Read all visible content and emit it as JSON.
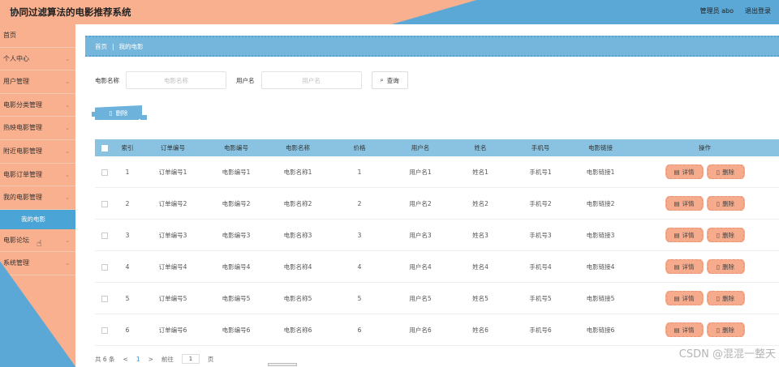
{
  "header": {
    "title": "协同过滤算法的电影推荐系统",
    "admin_label": "管理员 abo",
    "logout_label": "退出登录"
  },
  "sidebar": {
    "items": [
      {
        "label": "首页",
        "chevron": false
      },
      {
        "label": "个人中心",
        "chevron": true
      },
      {
        "label": "用户管理",
        "chevron": true
      },
      {
        "label": "电影分类管理",
        "chevron": true
      },
      {
        "label": "热映电影管理",
        "chevron": true
      },
      {
        "label": "附近电影管理",
        "chevron": true
      },
      {
        "label": "电影订单管理",
        "chevron": true
      },
      {
        "label": "我的电影管理",
        "chevron": true
      }
    ],
    "active_sub": "我的电影",
    "items_after": [
      {
        "label": "电影论坛",
        "chevron": true
      },
      {
        "label": "系统管理",
        "chevron": true
      }
    ]
  },
  "breadcrumb": {
    "home": "首页",
    "separator": "|",
    "current": "我的电影"
  },
  "search": {
    "movie_label": "电影名称",
    "movie_placeholder": "电影名称",
    "user_label": "用户名",
    "user_placeholder": "用户名",
    "query_button": "查询"
  },
  "actions": {
    "delete_label": "删除"
  },
  "table": {
    "headers": [
      "索引",
      "订单编号",
      "电影编号",
      "电影名称",
      "价格",
      "用户名",
      "姓名",
      "手机号",
      "电影链接",
      "操作"
    ],
    "rows": [
      [
        "1",
        "订单编号1",
        "电影编号1",
        "电影名称1",
        "1",
        "用户名1",
        "姓名1",
        "手机号1",
        "电影链接1"
      ],
      [
        "2",
        "订单编号2",
        "电影编号2",
        "电影名称2",
        "2",
        "用户名2",
        "姓名2",
        "手机号2",
        "电影链接2"
      ],
      [
        "3",
        "订单编号3",
        "电影编号3",
        "电影名称3",
        "3",
        "用户名3",
        "姓名3",
        "手机号3",
        "电影链接3"
      ],
      [
        "4",
        "订单编号4",
        "电影编号4",
        "电影名称4",
        "4",
        "用户名4",
        "姓名4",
        "手机号4",
        "电影链接4"
      ],
      [
        "5",
        "订单编号5",
        "电影编号5",
        "电影名称5",
        "5",
        "用户名5",
        "姓名5",
        "手机号5",
        "电影链接5"
      ],
      [
        "6",
        "订单编号6",
        "电影编号6",
        "电影名称6",
        "6",
        "用户名6",
        "姓名6",
        "手机号6",
        "电影链接6"
      ]
    ],
    "detail_label": "详情",
    "delete_label": "删除"
  },
  "pagination": {
    "total": "共 6 条",
    "prev": "<",
    "page": "1",
    "next": ">",
    "goto_label": "前往",
    "goto_value": "1",
    "page_suffix": "页"
  },
  "watermark": "CSDN @混混一整天",
  "colors": {
    "header_peach": "#f9b08f",
    "header_blue": "#5ba8d6",
    "sidebar": "#f9b08f",
    "active_sub": "#4aa5d6",
    "table_header": "#8ac3e2",
    "op_button": "#f6ab8c"
  }
}
